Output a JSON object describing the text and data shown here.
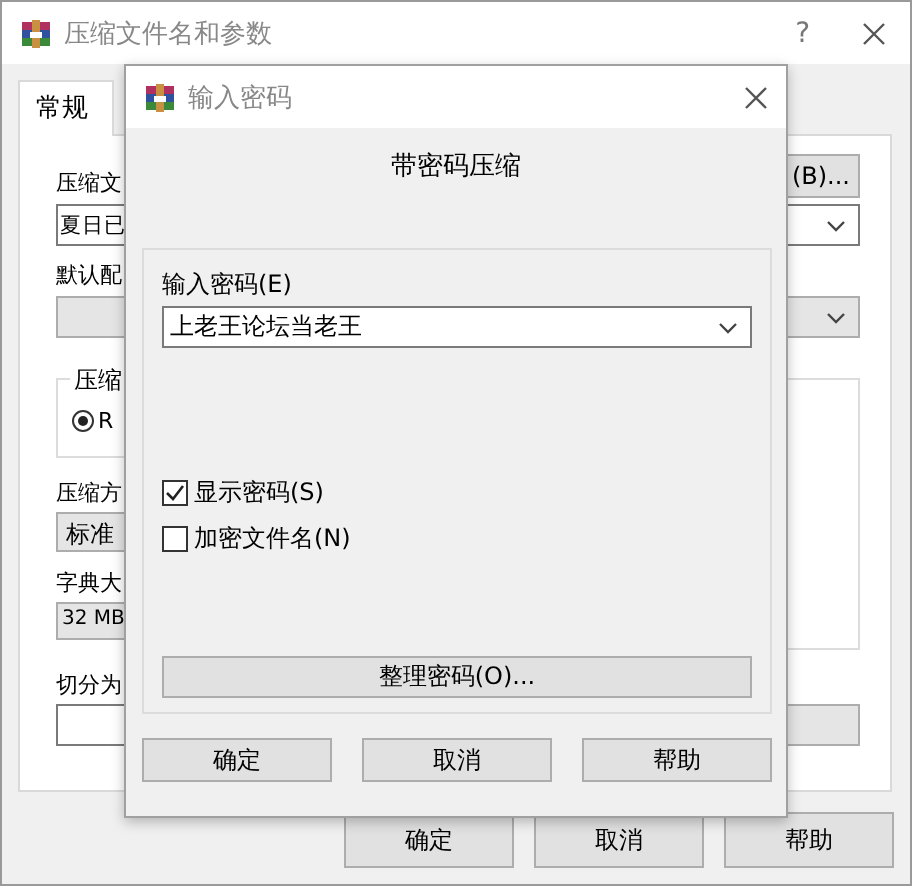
{
  "main_window": {
    "title": "压缩文件名和参数",
    "help_button": "?",
    "tabs": [
      {
        "label": "常规",
        "selected": true
      }
    ],
    "archive_label": "压缩文",
    "archive_value": "夏日已",
    "browse_button": "(B)...",
    "profile_label": "默认配",
    "format_group_label": "压缩",
    "format_options": [
      {
        "label": "R",
        "selected": true
      }
    ],
    "method_label": "压缩方",
    "method_value": "标准",
    "dictionary_label": "字典大",
    "dictionary_value": "32 MB",
    "split_label": "切分为",
    "buttons": [
      "确定",
      "取消",
      "帮助"
    ]
  },
  "password_dialog": {
    "title": "输入密码",
    "heading": "带密码压缩",
    "password_label": "输入密码(E)",
    "password_value": "上老王论坛当老王",
    "options": [
      {
        "label": "显示密码(S)",
        "checked": true
      },
      {
        "label": "加密文件名(N)",
        "checked": false
      }
    ],
    "organize_button": "整理密码(O)...",
    "buttons": [
      "确定",
      "取消",
      "帮助"
    ]
  }
}
